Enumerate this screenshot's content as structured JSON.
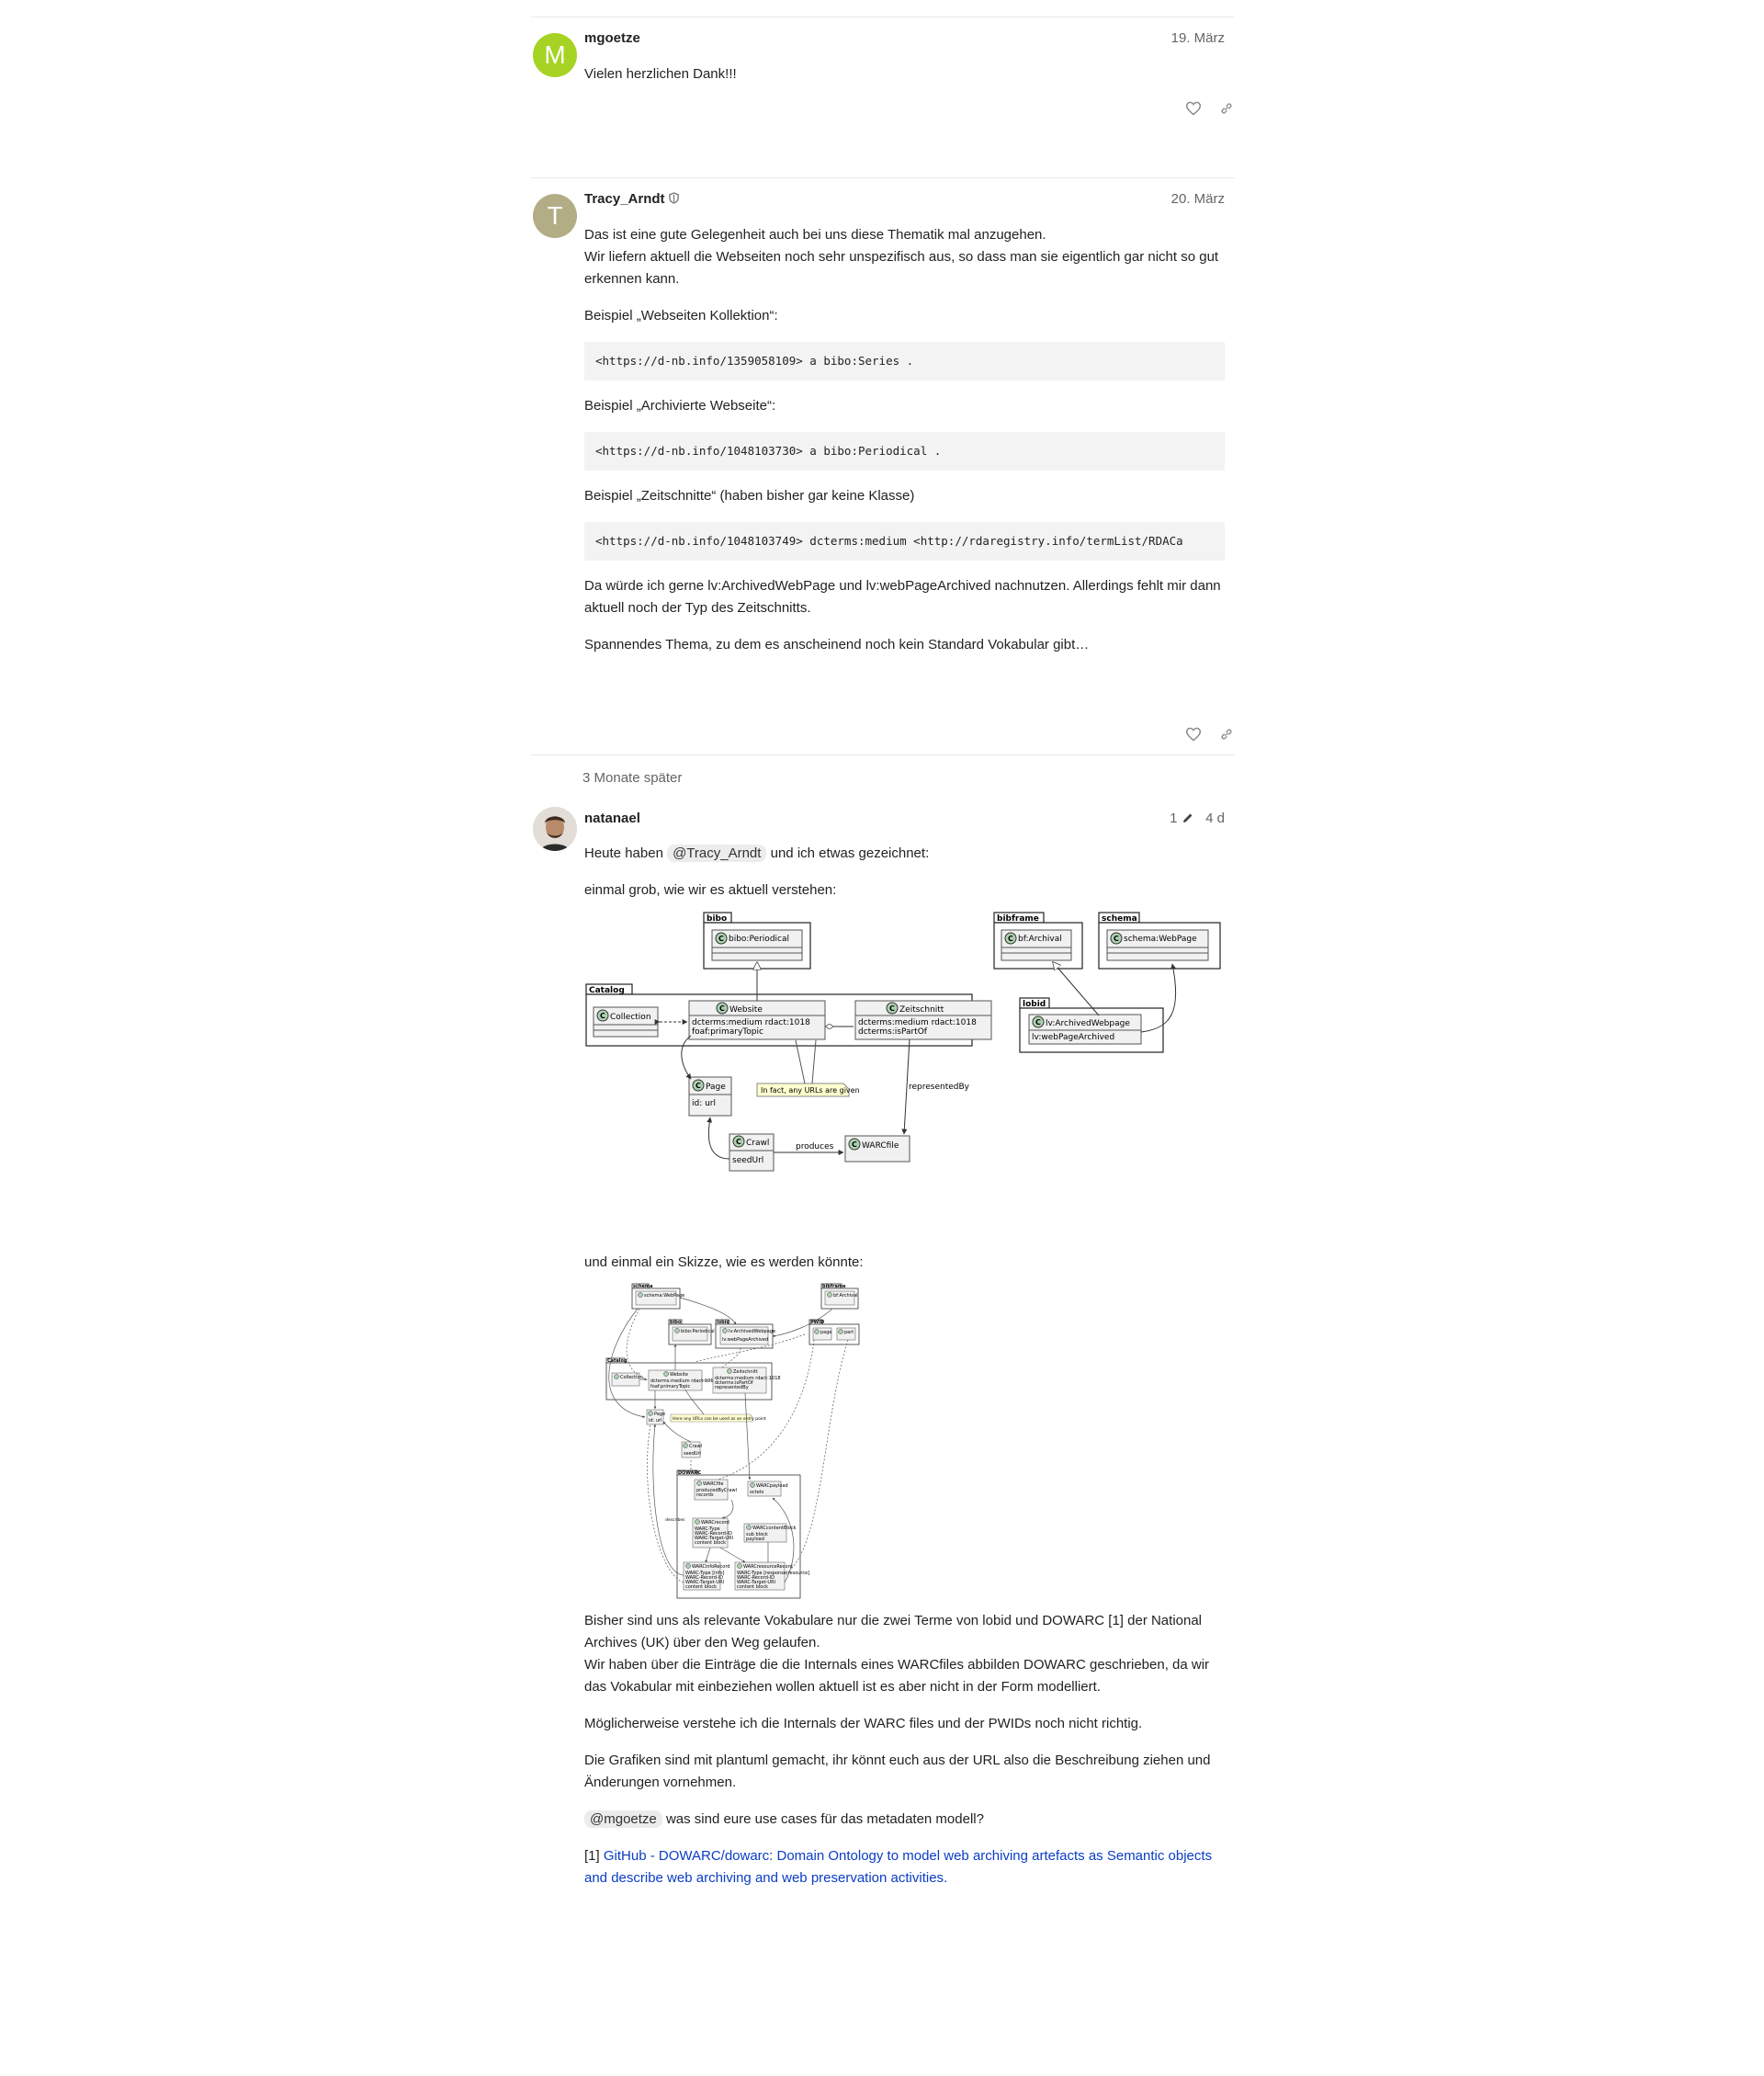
{
  "posts": [
    {
      "username": "mgoetze",
      "avatar_letter": "M",
      "avatar_color": "#a6d323",
      "date": "19. März",
      "paragraphs": [
        "Vielen herzlichen Dank!!!"
      ]
    },
    {
      "username": "Tracy_Arndt",
      "avatar_letter": "T",
      "avatar_color": "#b3ad85",
      "badge_icon": "shield-icon",
      "date": "20. März",
      "p1_line1": "Das ist eine gute Gelegenheit auch bei uns diese Thematik mal anzugehen.",
      "p1_line2": "Wir liefern aktuell die Webseiten noch sehr unspezifisch aus, so dass man sie eigentlich gar nicht so gut erkennen kann.",
      "ex1_label": "Beispiel „Webseiten Kollektion“:",
      "ex1_code": "<https://d-nb.info/1359058109> a bibo:Series .",
      "ex2_label": "Beispiel „Archivierte Webseite“:",
      "ex2_code": "<https://d-nb.info/1048103730> a bibo:Periodical .",
      "ex3_label": "Beispiel „Zeitschnitte“ (haben bisher gar keine Klasse)",
      "ex3_code": "<https://d-nb.info/1048103749> dcterms:medium <http://rdaregistry.info/termList/RDACa",
      "p_after": "Da würde ich gerne lv:ArchivedWebPage und lv:webPageArchived nachnutzen. Allerdings fehlt mir dann aktuell noch der Typ des Zeitschnitts.",
      "p_last": "Spannendes Thema, zu dem es anscheinend noch kein Standard Vokabular gibt…"
    }
  ],
  "time_gap": "3 Monate später",
  "post3": {
    "username": "natanael",
    "edit_count": "1",
    "date": "4 d",
    "p1_before": "Heute haben",
    "mention1": "@Tracy_Arndt",
    "p1_after": "und ich etwas gezeichnet:",
    "p2": "einmal grob, wie wir es aktuell verstehen:",
    "p3": "und einmal ein Skizze, wie es werden könnte:",
    "p4_line1": "Bisher sind uns als relevante Vokabulare nur die zwei Terme von lobid und DOWARC [1] der National Archives (UK) über den Weg gelaufen.",
    "p4_line2": "Wir haben über die Einträge die die Internals eines WARCfiles abbilden DOWARC geschrieben, da wir das Vokabular mit einbeziehen wollen aktuell ist es aber nicht in der Form modelliert.",
    "p5": "Möglicherweise verstehe ich die Internals der WARC files und der PWIDs noch nicht richtig.",
    "p6": "Die Grafiken sind mit plantuml gemacht, ihr könnt euch aus der URL also die Beschreibung ziehen und Änderungen vornehmen.",
    "mention2": "@mgoetze",
    "p7_after": "was sind eure use cases für das metadaten modell?",
    "ref_prefix": "[1]",
    "ref_link": "GitHub - DOWARC/dowarc: Domain Ontology to model web archiving artefacts as Semantic objects and describe web archiving and web preservation activities."
  },
  "diagram1": {
    "pkg_bibo": "bibo",
    "cls_bibo_periodical": "bibo:Periodical",
    "pkg_bibframe": "bibframe",
    "cls_bf_archival": "bf:Archival",
    "pkg_schema": "schema",
    "cls_schema_webpage": "schema:WebPage",
    "pkg_catalog": "Catalog",
    "cls_collection": "Collection",
    "cls_website": "Website",
    "website_attr1": "dcterms:medium rdact:1018",
    "website_attr2": "foaf:primaryTopic",
    "cls_zeitschnitt": "Zeitschnitt",
    "zeit_attr1": "dcterms:medium rdact:1018",
    "zeit_attr2": "dcterms:isPartOf",
    "pkg_lobid": "lobid",
    "cls_lv": "lv:ArchivedWebpage",
    "lv_attr": "lv:webPageArchived",
    "cls_page": "Page",
    "page_attr": "id: url",
    "note": "In fact, any URLs are given",
    "edge_represented": "representedBy",
    "cls_crawl": "Crawl",
    "crawl_attr": "seedUrl",
    "edge_produces": "produces",
    "cls_warc": "WARCfile"
  },
  "diagram2": {
    "pkg_schema": "schema",
    "cls_schema": "schema:WebPage",
    "pkg_bibframe": "bibframe",
    "cls_bf": "bf:Archival",
    "pkg_bibo": "bibo",
    "cls_bibo": "bibo:Periodical",
    "pkg_lobid": "lobid",
    "cls_lv": "lv:ArchivedWebpage",
    "lv_attr": "lv:webPageArchived",
    "pkg_pwid": "PWID",
    "cls_page_p": "page",
    "cls_part": "part",
    "pkg_catalog": "Catalog",
    "cls_collection": "Collection",
    "cls_website": "Website",
    "website_attr1": "dcterms:medium rdact:1018",
    "website_attr2": "foaf:primaryTopic",
    "cls_zeit": "Zeitschnitt",
    "zeit_attr1": "dcterms:medium rdact:1018",
    "zeit_attr2": "dcterms:isPartOf",
    "zeit_attr3": "representedBy",
    "cls_page": "Page",
    "page_attr": "id: url",
    "note": "Here any URLs can be used as an entry point",
    "cls_crawl": "Crawl",
    "crawl_attr": "seedUrl",
    "pkg_dowarc": "DOWARC",
    "cls_warcfile": "WARCfile",
    "warcfile_attr1": "producedByCrawl",
    "warcfile_attr2": "records",
    "cls_payload": "WARCpayload",
    "payload_attr": "octets",
    "cls_record": "WARCrecord",
    "record_attr1": "WARC-Type",
    "record_attr2": "WARC-Record-ID",
    "record_attr3": "WARC-Target-URI",
    "record_attr4": "content block",
    "cls_content": "WARCcontentBlock",
    "content_attr1": "sub block",
    "content_attr2": "payload",
    "cls_info": "WARCinfoRecord",
    "info_attr1": "WARC-Type [info]",
    "info_attr2": "WARC-Record-ID",
    "info_attr3": "WARC-Target-URI",
    "info_attr4": "content block",
    "cls_resource": "WARCresourceRecord",
    "res_attr1": "WARC-Type [response|resource]",
    "res_attr2": "WARC-Record-ID",
    "res_attr3": "WARC-Target-URI",
    "res_attr4": "content block",
    "edge_describes": "describes"
  }
}
